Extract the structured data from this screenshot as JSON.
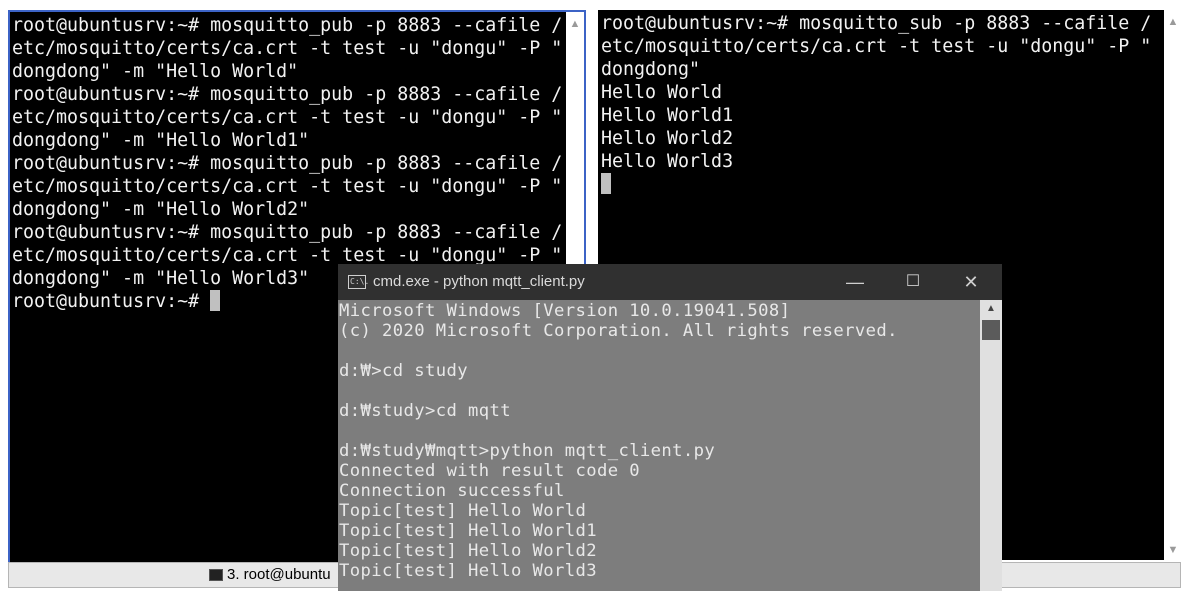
{
  "left_terminal": {
    "lines": [
      "root@ubuntusrv:~# mosquitto_pub -p 8883 --cafile /",
      "etc/mosquitto/certs/ca.crt -t test -u \"dongu\" -P \"",
      "dongdong\" -m \"Hello World\"",
      "root@ubuntusrv:~# mosquitto_pub -p 8883 --cafile /",
      "etc/mosquitto/certs/ca.crt -t test -u \"dongu\" -P \"",
      "dongdong\" -m \"Hello World1\"",
      "root@ubuntusrv:~# mosquitto_pub -p 8883 --cafile /",
      "etc/mosquitto/certs/ca.crt -t test -u \"dongu\" -P \"",
      "dongdong\" -m \"Hello World2\"",
      "root@ubuntusrv:~# mosquitto_pub -p 8883 --cafile /",
      "etc/mosquitto/certs/ca.crt -t test -u \"dongu\" -P \"",
      "dongdong\" -m \"Hello World3\""
    ],
    "prompt": "root@ubuntusrv:~# "
  },
  "right_terminal": {
    "lines": [
      "root@ubuntusrv:~# mosquitto_sub -p 8883 --cafile /",
      "etc/mosquitto/certs/ca.crt -t test -u \"dongu\" -P \"",
      "dongdong\"",
      "Hello World",
      "Hello World1",
      "Hello World2",
      "Hello World3"
    ]
  },
  "taskbar": {
    "item_label": "3. root@ubuntu"
  },
  "cmd_window": {
    "title": "cmd.exe - python  mqtt_client.py",
    "icon_label": "C:\\.",
    "minimize": "—",
    "maximize": "☐",
    "close": "✕",
    "lines": [
      "Microsoft Windows [Version 10.0.19041.508]",
      "(c) 2020 Microsoft Corporation. All rights reserved.",
      "",
      "d:₩>cd study",
      "",
      "d:₩study>cd mqtt",
      "",
      "d:₩study₩mqtt>python mqtt_client.py",
      "Connected with result code 0",
      "Connection successful",
      "Topic[test] Hello World",
      "Topic[test] Hello World1",
      "Topic[test] Hello World2",
      "Topic[test] Hello World3"
    ]
  },
  "colors": {
    "terminal_bg": "#000000",
    "cmd_bg": "#7d7d7d",
    "cmd_titlebar": "#303030",
    "left_border": "#3c63c6"
  }
}
